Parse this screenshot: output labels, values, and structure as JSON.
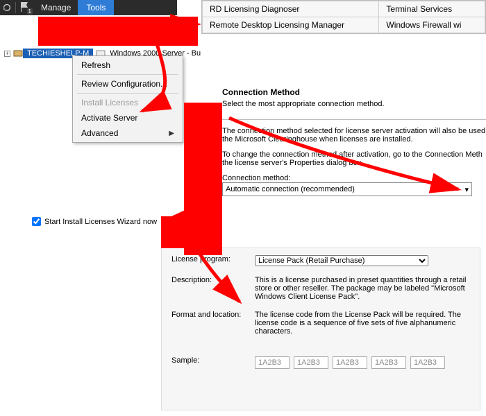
{
  "titlebar": {
    "flag_badge": "1",
    "manage": "Manage",
    "tools": "Tools"
  },
  "submenu": {
    "col1_row1": "RD Licensing Diagnoser",
    "col1_row2": "Remote Desktop Licensing Manager",
    "col2_row1": "Terminal Services",
    "col2_row2": "Windows Firewall wi"
  },
  "tree": {
    "node": "TECHIESHELP-M",
    "suffix": "Windows 2000 Server - Bu"
  },
  "context_menu": {
    "refresh": "Refresh",
    "review": "Review Configuration...",
    "install": "Install Licenses",
    "activate": "Activate Server",
    "advanced": "Advanced"
  },
  "conn": {
    "title": "Connection Method",
    "sub": "Select the most appropriate connection method.",
    "p1": "The connection method selected for license server activation will also be used the Microsoft Clearinghouse when licenses are installed.",
    "p2": "To change the connection method after activation, go to the Connection Meth the license server's Properties dialog box.",
    "label": "Connection method:",
    "value": "Automatic connection (recommended)"
  },
  "checkbox": {
    "label": "Start Install Licenses Wizard now"
  },
  "lic": {
    "program_label": "License program:",
    "program_value": "License Pack (Retail Purchase)",
    "desc_label": "Description:",
    "desc_value": "This is a license purchased in preset quantities through a retail store or other reseller. The package may be labeled \"Microsoft Windows Client License Pack\".",
    "fmt_label": "Format and location:",
    "fmt_value": "The license code from the License Pack will be required. The license code is a sequence of five sets of five alphanumeric characters.",
    "sample_label": "Sample:",
    "sample": "1A2B3"
  }
}
